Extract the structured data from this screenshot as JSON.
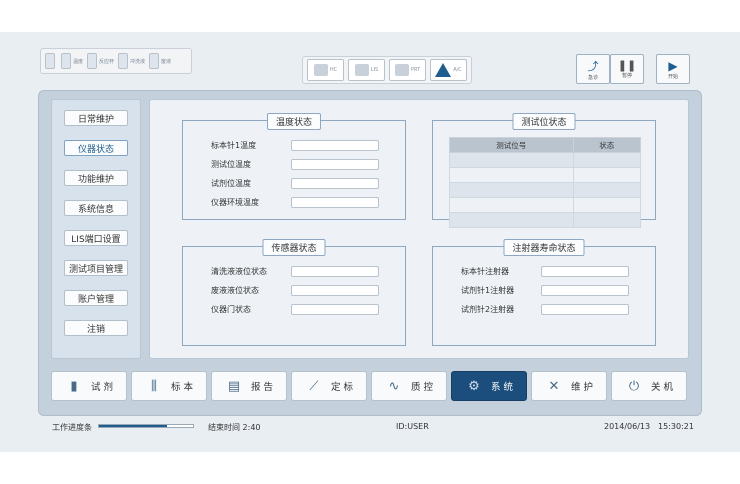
{
  "toolbar": {
    "left_items": [
      {
        "label": "",
        "icon": "reagent-bottle-icon"
      },
      {
        "label": "温度",
        "icon": "thermometer-icon"
      },
      {
        "label": "反应杯",
        "icon": "cuvette-icon"
      },
      {
        "label": "冲洗液",
        "icon": "wash-liquid-icon"
      },
      {
        "label": "废液",
        "icon": "waste-liquid-icon"
      }
    ],
    "middle_items": [
      {
        "label": "HC",
        "icon": "host-computer-icon"
      },
      {
        "label": "LIS",
        "icon": "lis-icon"
      },
      {
        "label": "PRT",
        "icon": "printer-icon"
      },
      {
        "label": "A/C",
        "icon": "warning-icon"
      }
    ],
    "emergency_label": "急诊",
    "pause_label": "暂停",
    "start_label": "开始"
  },
  "nav": {
    "items": [
      "日常维护",
      "仪器状态",
      "功能维护",
      "系统信息",
      "LIS端口设置",
      "测试项目管理",
      "账户管理",
      "注销"
    ],
    "active_index": 1
  },
  "temperature_panel": {
    "title": "温度状态",
    "rows": [
      {
        "label": "标本针1温度",
        "value": ""
      },
      {
        "label": "测试位温度",
        "value": ""
      },
      {
        "label": "试剂位温度",
        "value": ""
      },
      {
        "label": "仪器环境温度",
        "value": ""
      }
    ]
  },
  "test_position_panel": {
    "title": "测试位状态",
    "columns": [
      "测试位号",
      "状态"
    ],
    "rows": [
      [
        "",
        ""
      ],
      [
        "",
        ""
      ],
      [
        "",
        ""
      ],
      [
        "",
        ""
      ],
      [
        "",
        ""
      ]
    ]
  },
  "sensor_panel": {
    "title": "传感器状态",
    "rows": [
      {
        "label": "清洗液液位状态",
        "value": ""
      },
      {
        "label": "废液液位状态",
        "value": ""
      },
      {
        "label": "仪器门状态",
        "value": ""
      }
    ]
  },
  "syringe_panel": {
    "title": "注射器寿命状态",
    "rows": [
      {
        "label": "标本针注射器",
        "value": ""
      },
      {
        "label": "试剂针1注射器",
        "value": ""
      },
      {
        "label": "试剂针2注射器",
        "value": ""
      }
    ]
  },
  "bottom_tabs": [
    {
      "label": "试 剂",
      "icon": "reagent-icon"
    },
    {
      "label": "标 本",
      "icon": "sample-tubes-icon"
    },
    {
      "label": "报 告",
      "icon": "report-icon"
    },
    {
      "label": "定 标",
      "icon": "calibration-curve-icon"
    },
    {
      "label": "质 控",
      "icon": "qc-chart-icon"
    },
    {
      "label": "系 统",
      "icon": "gears-icon"
    },
    {
      "label": "维 护",
      "icon": "tools-icon"
    },
    {
      "label": "关 机",
      "icon": "power-icon"
    }
  ],
  "active_tab_index": 5,
  "colors": {
    "accent": "#1b4e7c"
  },
  "status": {
    "progress_label": "工作进度条",
    "progress_value": 0.72,
    "end_time": "结束时间  2:40",
    "user": "ID:USER",
    "date": "2014/06/13",
    "time": "15:30:21"
  }
}
